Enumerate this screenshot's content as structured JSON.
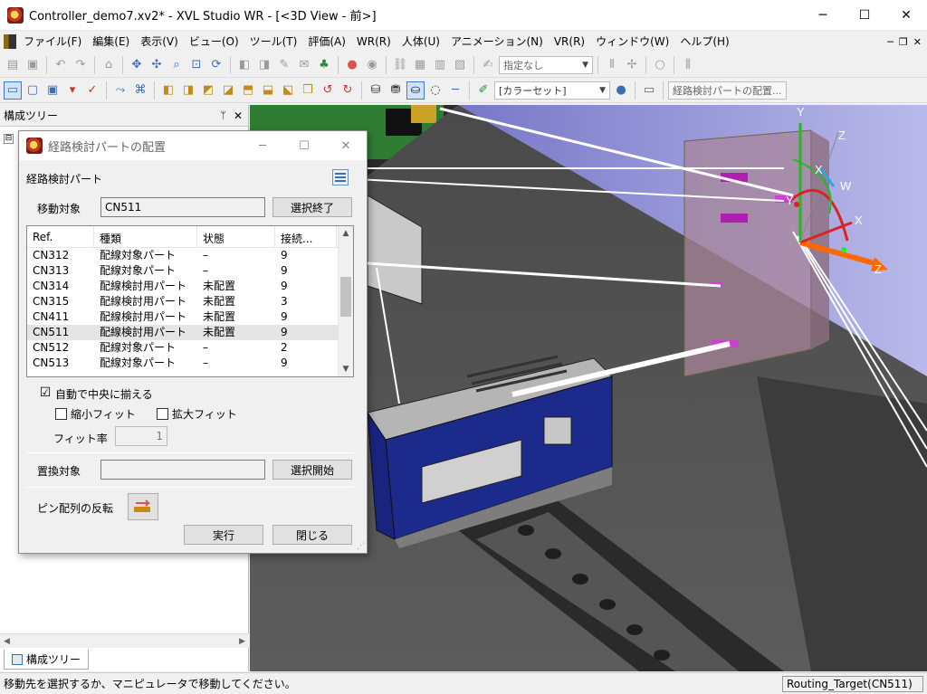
{
  "window": {
    "title": "Controller_demo7.xv2* - XVL Studio WR - [<3D View - 前>]",
    "minimize": "─",
    "maximize": "☐",
    "close": "✕"
  },
  "menu": {
    "items": [
      "ファイル(F)",
      "編集(E)",
      "表示(V)",
      "ビュー(O)",
      "ツール(T)",
      "評価(A)",
      "WR(R)",
      "人体(U)",
      "アニメーション(N)",
      "VR(R)",
      "ウィンドウ(W)",
      "ヘルプ(H)"
    ],
    "doc_min": "─",
    "doc_restore": "❐",
    "doc_close": "✕"
  },
  "toolbar1": {
    "combo_value": "指定なし"
  },
  "toolbar2": {
    "color_set": "[カラーセット]",
    "route_button": "経路検討パートの配置..."
  },
  "left_panel": {
    "title": "構成ツリー",
    "pin": "ᛘ",
    "close": "✕",
    "tree_expander": "⊟",
    "tab_label": "構成ツリー"
  },
  "dialog": {
    "title": "経路検討パートの配置",
    "section": "経路検討パート",
    "move_target_label": "移動対象",
    "move_target_value": "CN511",
    "finish_select_button": "選択終了",
    "columns": [
      "Ref.",
      "種類",
      "状態",
      "接続..."
    ],
    "rows": [
      {
        "ref": "CN312",
        "type": "配線対象パート",
        "state": "–",
        "conn": "9"
      },
      {
        "ref": "CN313",
        "type": "配線対象パート",
        "state": "–",
        "conn": "9"
      },
      {
        "ref": "CN314",
        "type": "配線検討用パート",
        "state": "未配置",
        "conn": "9"
      },
      {
        "ref": "CN315",
        "type": "配線検討用パート",
        "state": "未配置",
        "conn": "3"
      },
      {
        "ref": "CN411",
        "type": "配線検討用パート",
        "state": "未配置",
        "conn": "9"
      },
      {
        "ref": "CN511",
        "type": "配線検討用パート",
        "state": "未配置",
        "conn": "9"
      },
      {
        "ref": "CN512",
        "type": "配線対象パート",
        "state": "–",
        "conn": "2"
      },
      {
        "ref": "CN513",
        "type": "配線対象パート",
        "state": "–",
        "conn": "9"
      }
    ],
    "auto_center_label": "自動で中央に揃える",
    "auto_center_checked": "☑",
    "shrink_fit_label": "縮小フィット",
    "expand_fit_label": "拡大フィット",
    "fit_rate_label": "フィット率",
    "fit_rate_value": "1",
    "replace_target_label": "置換対象",
    "start_select_button": "選択開始",
    "pin_flip_label": "ピン配列の反転",
    "execute_button": "実行",
    "close_button": "閉じる"
  },
  "viewport": {
    "axis_labels": [
      "Y",
      "Z",
      "X",
      "W",
      "Y",
      "X",
      "Z"
    ]
  },
  "status": {
    "message": "移動先を選択するか、マニピュレータで移動してください。",
    "right": "Routing_Target(CN511)"
  }
}
